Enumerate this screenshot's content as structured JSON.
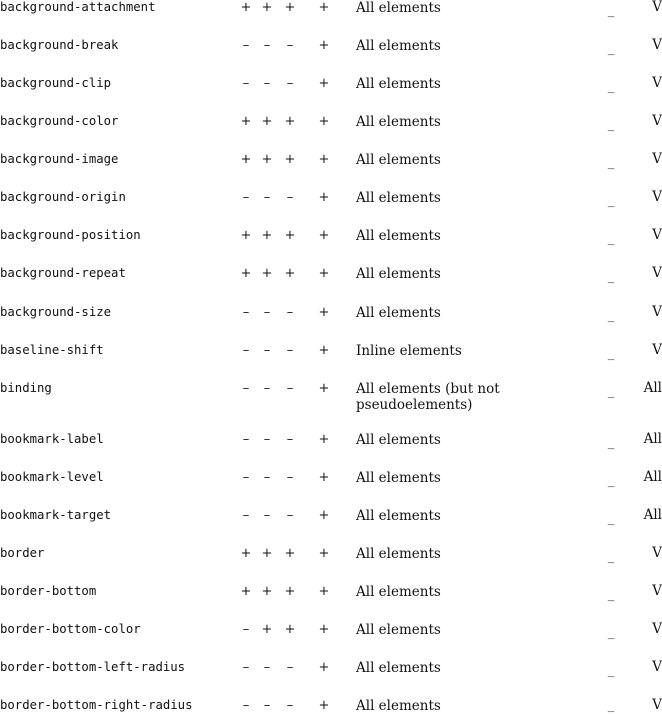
{
  "rows": [
    {
      "property": "background-attachment",
      "v1": "+",
      "v2": "+",
      "v3": "+",
      "v4": "+",
      "applies_to": "All elements",
      "inherited": "_",
      "media": "V"
    },
    {
      "property": "background-break",
      "v1": "–",
      "v2": "–",
      "v3": "–",
      "v4": "+",
      "applies_to": "All elements",
      "inherited": "_",
      "media": "V"
    },
    {
      "property": "background-clip",
      "v1": "–",
      "v2": "–",
      "v3": "–",
      "v4": "+",
      "applies_to": "All elements",
      "inherited": "_",
      "media": "V"
    },
    {
      "property": "background-color",
      "v1": "+",
      "v2": "+",
      "v3": "+",
      "v4": "+",
      "applies_to": "All elements",
      "inherited": "_",
      "media": "V"
    },
    {
      "property": "background-image",
      "v1": "+",
      "v2": "+",
      "v3": "+",
      "v4": "+",
      "applies_to": "All elements",
      "inherited": "_",
      "media": "V"
    },
    {
      "property": "background-origin",
      "v1": "–",
      "v2": "–",
      "v3": "–",
      "v4": "+",
      "applies_to": "All elements",
      "inherited": "_",
      "media": "V"
    },
    {
      "property": "background-position",
      "v1": "+",
      "v2": "+",
      "v3": "+",
      "v4": "+",
      "applies_to": "All elements",
      "inherited": "_",
      "media": "V"
    },
    {
      "property": "background-repeat",
      "v1": "+",
      "v2": "+",
      "v3": "+",
      "v4": "+",
      "applies_to": "All elements",
      "inherited": "_",
      "media": "V"
    },
    {
      "property": "background-size",
      "v1": "–",
      "v2": "–",
      "v3": "–",
      "v4": "+",
      "applies_to": "All elements",
      "inherited": "_",
      "media": "V"
    },
    {
      "property": "baseline-shift",
      "v1": "–",
      "v2": "–",
      "v3": "–",
      "v4": "+",
      "applies_to": "Inline elements",
      "inherited": "_",
      "media": "V"
    },
    {
      "property": "binding",
      "v1": "–",
      "v2": "–",
      "v3": "–",
      "v4": "+",
      "applies_to": "All elements (but not pseudoelements)",
      "inherited": "_",
      "media": "All"
    },
    {
      "property": "bookmark-label",
      "v1": "–",
      "v2": "–",
      "v3": "–",
      "v4": "+",
      "applies_to": "All elements",
      "inherited": "_",
      "media": "All"
    },
    {
      "property": "bookmark-level",
      "v1": "–",
      "v2": "–",
      "v3": "–",
      "v4": "+",
      "applies_to": "All elements",
      "inherited": "_",
      "media": "All"
    },
    {
      "property": "bookmark-target",
      "v1": "–",
      "v2": "–",
      "v3": "–",
      "v4": "+",
      "applies_to": "All elements",
      "inherited": "_",
      "media": "All"
    },
    {
      "property": "border",
      "v1": "+",
      "v2": "+",
      "v3": "+",
      "v4": "+",
      "applies_to": "All elements",
      "inherited": "_",
      "media": "V"
    },
    {
      "property": "border-bottom",
      "v1": "+",
      "v2": "+",
      "v3": "+",
      "v4": "+",
      "applies_to": "All elements",
      "inherited": "_",
      "media": "V"
    },
    {
      "property": "border-bottom-color",
      "v1": "–",
      "v2": "+",
      "v3": "+",
      "v4": "+",
      "applies_to": "All elements",
      "inherited": "_",
      "media": "V"
    },
    {
      "property": "border-bottom-left-radius",
      "v1": "–",
      "v2": "–",
      "v3": "–",
      "v4": "+",
      "applies_to": "All elements",
      "inherited": "_",
      "media": "V"
    },
    {
      "property": "border-bottom-right-radius",
      "v1": "–",
      "v2": "–",
      "v3": "–",
      "v4": "+",
      "applies_to": "All elements",
      "inherited": "_",
      "media": "V"
    }
  ]
}
